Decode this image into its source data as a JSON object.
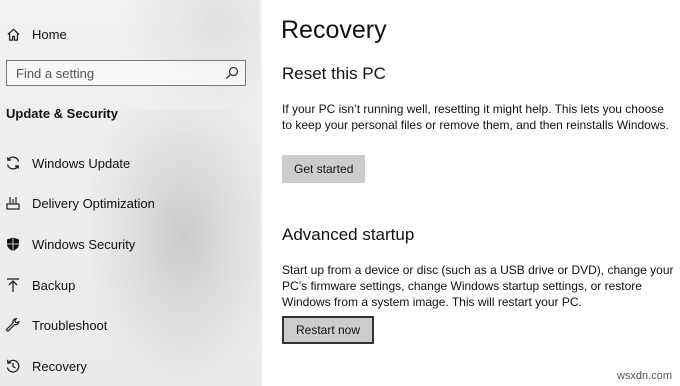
{
  "sidebar": {
    "home_label": "Home",
    "search": {
      "placeholder": "Find a setting"
    },
    "section_title": "Update & Security",
    "items": [
      {
        "label": "Windows Update",
        "icon": "refresh-icon"
      },
      {
        "label": "Delivery Optimization",
        "icon": "delivery-optimization-icon"
      },
      {
        "label": "Windows Security",
        "icon": "shield-icon"
      },
      {
        "label": "Backup",
        "icon": "backup-arrow-icon"
      },
      {
        "label": "Troubleshoot",
        "icon": "wrench-icon"
      },
      {
        "label": "Recovery",
        "icon": "recovery-icon"
      }
    ],
    "selected_item": "Recovery"
  },
  "main": {
    "title": "Recovery",
    "reset": {
      "heading": "Reset this PC",
      "description": "If your PC isn’t running well, resetting it might help. This lets you choose to keep your personal files or remove them, and then reinstalls Windows.",
      "button_label": "Get started"
    },
    "advanced": {
      "heading": "Advanced startup",
      "description": "Start up from a device or disc (such as a USB drive or DVD), change your PC’s firmware settings, change Windows startup settings, or restore Windows from a system image. This will restart your PC.",
      "button_label": "Restart now"
    }
  },
  "watermark": "wsxdn.com",
  "colors": {
    "sidebar_bg": "#eeeeee",
    "button_bg": "#cccccc",
    "button_focus_border": "#333333",
    "text": "#111111"
  }
}
